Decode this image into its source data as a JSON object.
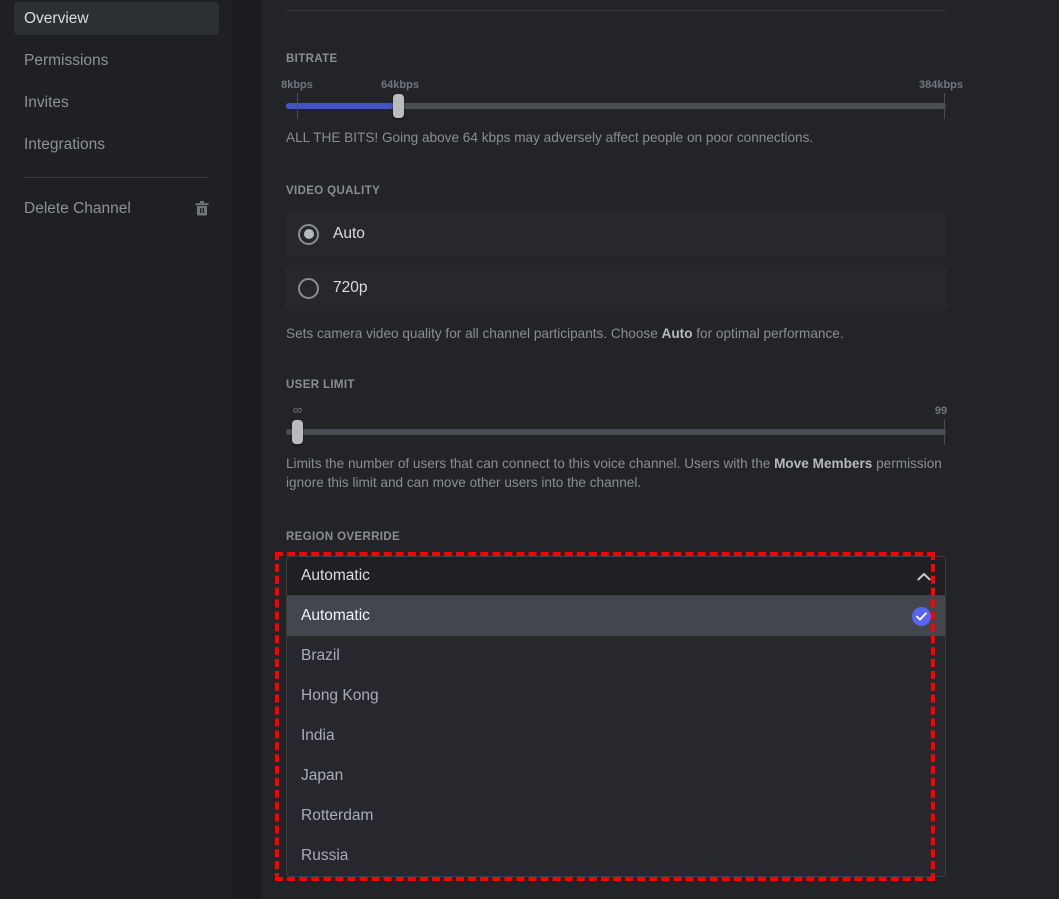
{
  "sidebar": {
    "items": [
      {
        "label": "Overview",
        "active": true
      },
      {
        "label": "Permissions",
        "active": false
      },
      {
        "label": "Invites",
        "active": false
      },
      {
        "label": "Integrations",
        "active": false
      }
    ],
    "delete": {
      "label": "Delete Channel",
      "icon": "trash-icon"
    }
  },
  "bitrate": {
    "label": "Bitrate",
    "min_label": "8kbps",
    "value_label": "64kbps",
    "max_label": "384kbps",
    "value": 64,
    "min": 8,
    "max": 384,
    "fill_percent": 16,
    "description_prefix": "ALL THE BITS! Going above 64 kbps may adversely affect people on poor connections."
  },
  "video_quality": {
    "label": "Video Quality",
    "options": [
      {
        "label": "Auto",
        "selected": true
      },
      {
        "label": "720p",
        "selected": false
      }
    ],
    "description_1": "Sets camera video quality for all channel participants. Choose ",
    "description_bold": "Auto",
    "description_2": " for optimal performance."
  },
  "user_limit": {
    "label": "User Limit",
    "min_label": "∞",
    "max_label": "99",
    "value": 0,
    "min": 0,
    "max": 99,
    "fill_percent": 0,
    "description_1": "Limits the number of users that can connect to this voice channel. Users with the ",
    "description_bold": "Move Members",
    "description_2": " permission ignore this limit and can move other users into the channel."
  },
  "region_override": {
    "label": "Region Override",
    "selected_value": "Automatic",
    "expanded": true,
    "chevron_icon": "chevron-up-icon",
    "options": [
      {
        "label": "Automatic",
        "selected": true
      },
      {
        "label": "Brazil",
        "selected": false
      },
      {
        "label": "Hong Kong",
        "selected": false
      },
      {
        "label": "India",
        "selected": false
      },
      {
        "label": "Japan",
        "selected": false
      },
      {
        "label": "Rotterdam",
        "selected": false
      },
      {
        "label": "Russia",
        "selected": false
      }
    ]
  },
  "annotation": {
    "color": "#ff0000",
    "style": "dashed-highlight-box"
  }
}
